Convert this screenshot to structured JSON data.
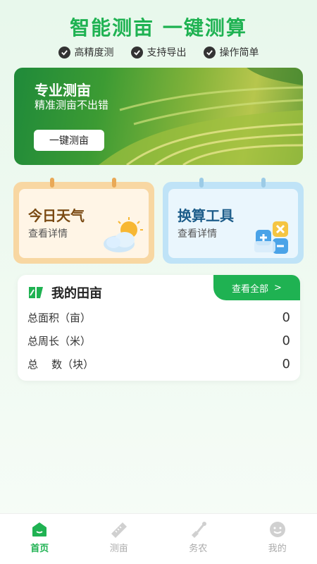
{
  "headline": "智能测亩  一键测算",
  "features": [
    "高精度测",
    "支持导出",
    "操作简单"
  ],
  "banner": {
    "title": "专业测亩",
    "subtitle": "精准测亩不出错",
    "button_label": "一键测亩"
  },
  "cards": {
    "weather": {
      "title": "今日天气",
      "link": "查看详情"
    },
    "tool": {
      "title": "换算工具",
      "link": "查看详情"
    }
  },
  "fields": {
    "title": "我的田亩",
    "view_all": "查看全部",
    "view_all_arrow": ">",
    "rows": [
      {
        "label": "总面积（亩）",
        "value": "0"
      },
      {
        "label": "总周长（米）",
        "value": "0"
      },
      {
        "label": "总    数（块）",
        "value": "0"
      }
    ]
  },
  "tabbar": [
    {
      "label": "首页",
      "icon": "home-icon",
      "active": true
    },
    {
      "label": "测亩",
      "icon": "ruler-icon",
      "active": false
    },
    {
      "label": "务农",
      "icon": "shovel-icon",
      "active": false
    },
    {
      "label": "我的",
      "icon": "profile-icon",
      "active": false
    }
  ],
  "colors": {
    "accent": "#1fb252",
    "weather_card": "#f8d7a2",
    "tool_card": "#bfe3f7"
  }
}
